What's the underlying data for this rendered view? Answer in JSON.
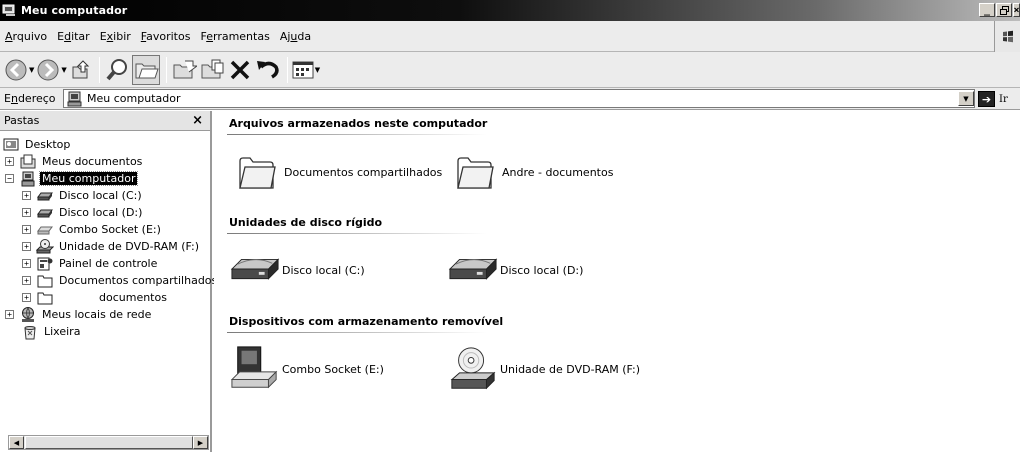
{
  "window": {
    "title": "Meu computador"
  },
  "title_buttons": [
    "_",
    "🗗",
    "×"
  ],
  "menu": {
    "items": [
      {
        "label": "Arquivo",
        "key": "A",
        "rest": "rquivo"
      },
      {
        "label": "Editar",
        "pre": "E",
        "key": "d",
        "rest": "itar"
      },
      {
        "label": "Exibir",
        "pre": "E",
        "key": "x",
        "rest": "ibir"
      },
      {
        "label": "Favoritos",
        "key": "F",
        "rest": "avoritos"
      },
      {
        "label": "Ferramentas",
        "pre": "F",
        "key": "e",
        "rest": "rramentas"
      },
      {
        "label": "Ajuda",
        "pre": "Aj",
        "key": "u",
        "rest": "da"
      }
    ]
  },
  "toolbar": {
    "buttons": [
      "back-button",
      "forward-button",
      "up-button",
      "search-button",
      "folders-button",
      "move-to-button",
      "copy-to-button",
      "delete-button",
      "undo-button",
      "views-button"
    ]
  },
  "address": {
    "label_pre": "E",
    "label_key": "n",
    "label_rest": "dereço",
    "value": "Meu computador",
    "go_label": "Ir"
  },
  "folders_pane": {
    "title": "Pastas",
    "close": "×",
    "tree": [
      {
        "label": "Desktop",
        "icon": "desktop-icon",
        "indent": 0,
        "expander": ""
      },
      {
        "label": "Meus documentos",
        "icon": "my-documents-icon",
        "indent": 1,
        "expander": "+"
      },
      {
        "label": "Meu computador",
        "icon": "my-computer-icon",
        "indent": 1,
        "expander": "−",
        "selected": true
      },
      {
        "label": "Disco local (C:)",
        "icon": "hard-disk-icon",
        "indent": 2,
        "expander": "+"
      },
      {
        "label": "Disco local (D:)",
        "icon": "hard-disk-icon",
        "indent": 2,
        "expander": "+"
      },
      {
        "label": "Combo Socket (E:)",
        "icon": "removable-drive-icon",
        "indent": 2,
        "expander": "+"
      },
      {
        "label": "Unidade de DVD-RAM (F:)",
        "icon": "dvd-drive-icon",
        "indent": 2,
        "expander": "+"
      },
      {
        "label": "Painel de controle",
        "icon": "control-panel-icon",
        "indent": 2,
        "expander": "+"
      },
      {
        "label": "Documentos compartilhados",
        "icon": "shared-folder-icon",
        "indent": 2,
        "expander": "+"
      },
      {
        "label": "documentos",
        "icon": "folder-icon",
        "indent": 2,
        "expander": "+",
        "offset": true
      },
      {
        "label": "Meus locais de rede",
        "icon": "network-places-icon",
        "indent": 1,
        "expander": "+"
      },
      {
        "label": "Lixeira",
        "icon": "recycle-bin-icon",
        "indent": 1,
        "expander": ""
      }
    ]
  },
  "content": {
    "groups": [
      {
        "title": "Arquivos armazenados neste computador",
        "items": [
          {
            "label": "Documentos compartilhados",
            "icon": "folder-icon"
          },
          {
            "label": "Andre - documentos",
            "icon": "folder-icon"
          }
        ]
      },
      {
        "title": "Unidades de disco rígido",
        "items": [
          {
            "label": "Disco local (C:)",
            "icon": "hard-disk-icon"
          },
          {
            "label": "Disco local (D:)",
            "icon": "hard-disk-icon"
          }
        ]
      },
      {
        "title": "Dispositivos com armazenamento removível",
        "items": [
          {
            "label": "Combo Socket (E:)",
            "icon": "removable-drive-icon"
          },
          {
            "label": "Unidade de DVD-RAM (F:)",
            "icon": "dvd-drive-icon"
          }
        ]
      }
    ]
  }
}
